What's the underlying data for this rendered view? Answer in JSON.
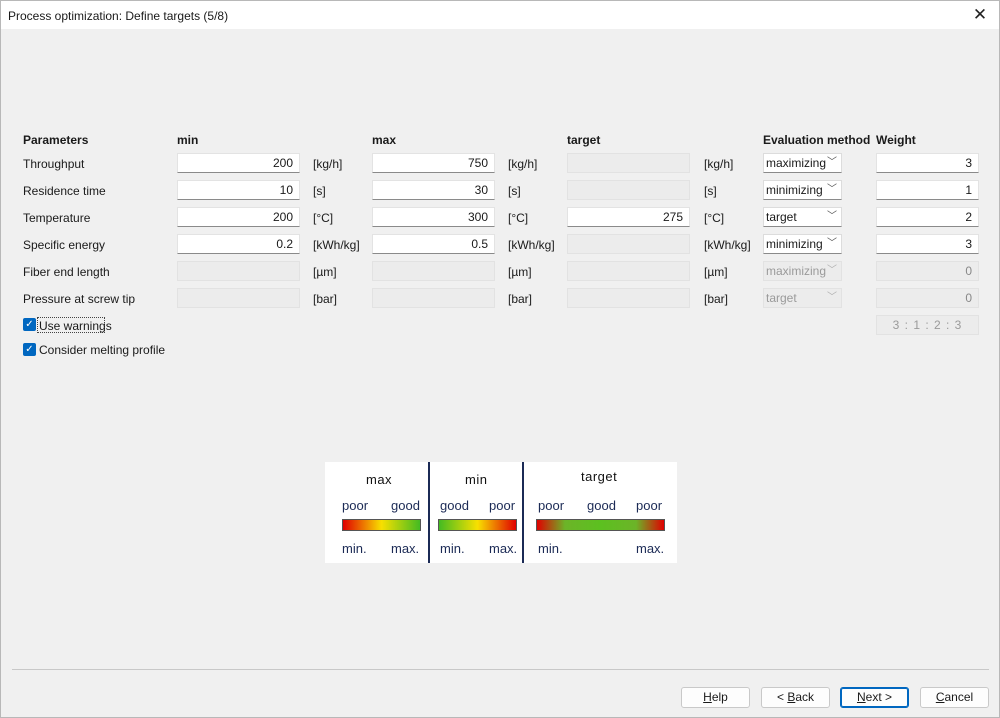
{
  "window": {
    "title": "Process optimization: Define targets (5/8)"
  },
  "headers": {
    "parameters": "Parameters",
    "min": "min",
    "max": "max",
    "target": "target",
    "evaluation": "Evaluation method",
    "weight": "Weight"
  },
  "rows": [
    {
      "label": "Throughput",
      "min": "200",
      "min_unit": "[kg/h]",
      "max": "750",
      "max_unit": "[kg/h]",
      "target": "",
      "target_unit": "[kg/h]",
      "method": "maximizing",
      "weight": "3"
    },
    {
      "label": "Residence time",
      "min": "10",
      "min_unit": "[s]",
      "max": "30",
      "max_unit": "[s]",
      "target": "",
      "target_unit": "[s]",
      "method": "minimizing",
      "weight": "1"
    },
    {
      "label": "Temperature",
      "min": "200",
      "min_unit": "[°C]",
      "max": "300",
      "max_unit": "[°C]",
      "target": "275",
      "target_unit": "[°C]",
      "method": "target",
      "weight": "2"
    },
    {
      "label": "Specific energy",
      "min": "0.2",
      "min_unit": "[kWh/kg]",
      "max": "0.5",
      "max_unit": "[kWh/kg]",
      "target": "",
      "target_unit": "[kWh/kg]",
      "method": "minimizing",
      "weight": "3"
    },
    {
      "label": "Fiber end length",
      "min": "",
      "min_unit": "[µm]",
      "max": "",
      "max_unit": "[µm]",
      "target": "",
      "target_unit": "[µm]",
      "method": "maximizing",
      "weight": "0"
    },
    {
      "label": "Pressure at screw tip",
      "min": "",
      "min_unit": "[bar]",
      "max": "",
      "max_unit": "[bar]",
      "target": "",
      "target_unit": "[bar]",
      "method": "target",
      "weight": "0"
    }
  ],
  "options": {
    "use_warnings": {
      "label": "Use warnings",
      "checked": true
    },
    "melting_profile": {
      "label": "Consider melting profile",
      "checked": true
    }
  },
  "weight_ratio": "3 : 1 : 2 : 3",
  "legend": {
    "max": {
      "title": "max",
      "left": "poor",
      "right": "good",
      "low": "min.",
      "high": "max."
    },
    "min": {
      "title": "min",
      "left": "good",
      "right": "poor",
      "low": "min.",
      "high": "max."
    },
    "target": {
      "title": "target",
      "left": "poor",
      "center": "good",
      "right": "poor",
      "low": "min.",
      "high": "max."
    }
  },
  "buttons": {
    "help": {
      "accel": "H",
      "rest": "elp"
    },
    "back": {
      "pre": "< ",
      "accel": "B",
      "rest": "ack"
    },
    "next": {
      "accel": "N",
      "rest": "ext >"
    },
    "cancel": {
      "accel": "C",
      "rest": "ancel"
    }
  },
  "colors": {
    "accent": "#0067c0",
    "legend_text": "#1b2a55"
  }
}
